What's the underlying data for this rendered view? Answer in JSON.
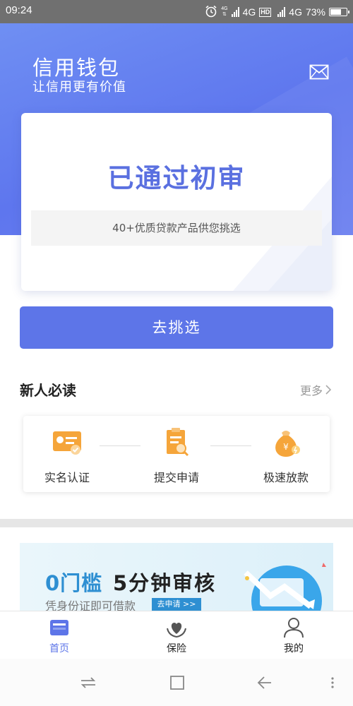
{
  "status_bar": {
    "time": "09:24",
    "network1": "4G",
    "network2": "4G",
    "hd": "HD",
    "tiny_net": "4G",
    "battery": "73%",
    "battery_level": 0.73
  },
  "header": {
    "title": "信用钱包",
    "subtitle": "让信用更有价值"
  },
  "card": {
    "status": "已通过初审",
    "note": "40+优质贷款产品供您挑选"
  },
  "cta": {
    "label": "去挑选"
  },
  "newcomer": {
    "title": "新人必读",
    "more": "更多",
    "steps": [
      {
        "label": "实名认证",
        "icon": "id-card-icon"
      },
      {
        "label": "提交申请",
        "icon": "clipboard-search-icon"
      },
      {
        "label": "极速放款",
        "icon": "money-bag-icon"
      }
    ]
  },
  "banner": {
    "highlight": "0门槛",
    "headline": "5分钟审核",
    "subtitle": "凭身份证即可借款",
    "button": "去申请 >>"
  },
  "tabs": [
    {
      "label": "首页",
      "icon": "home-card-icon",
      "active": true
    },
    {
      "label": "保险",
      "icon": "insurance-heart-icon",
      "active": false
    },
    {
      "label": "我的",
      "icon": "user-icon",
      "active": false
    }
  ],
  "colors": {
    "primary": "#5d75e8",
    "banner_accent": "#2e8fd2",
    "orange": "#f5a53a"
  }
}
